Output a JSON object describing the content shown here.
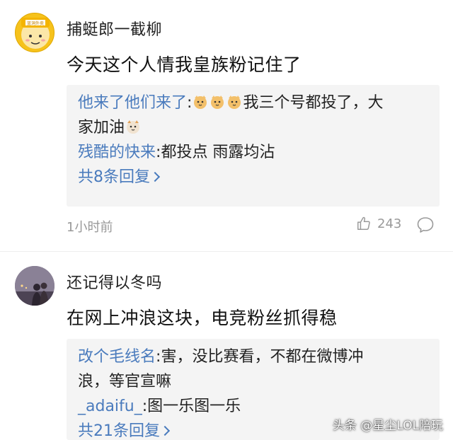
{
  "comments": [
    {
      "username": "捕蜓郎一截柳",
      "text": "今天这个人情我皇族粉记住了",
      "replies": [
        {
          "name": "他来了他们来了",
          "text_after_emojis": "我三个号都投了，大",
          "text_line2": "家加油"
        },
        {
          "name": "残酷的快来",
          "text": "都投点 雨露均沾"
        }
      ],
      "more_replies": "共8条回复",
      "time": "1小时前",
      "likes": "243",
      "avatar_badge": "蓝洞外卖"
    },
    {
      "username": "还记得以冬吗",
      "text": "在网上冲浪这块，电竞粉丝抓得稳",
      "replies": [
        {
          "name": "改个毛线名",
          "text": "害，没比赛看，不都在微博冲",
          "text_line2": "浪，等官宣嘛"
        },
        {
          "name": "_adaifu_",
          "text": "图一乐图一乐"
        }
      ],
      "more_replies": "共21条回复"
    }
  ],
  "watermark": "头条 @星尘LOL陪玩",
  "icons": [
    "thumbs-up-icon",
    "comment-bubble-icon",
    "cat-face-emoji",
    "chevron-right-icon"
  ],
  "colors": {
    "link": "#4a7bbd",
    "meta": "#999999",
    "reply_bg": "#f4f4f4"
  }
}
